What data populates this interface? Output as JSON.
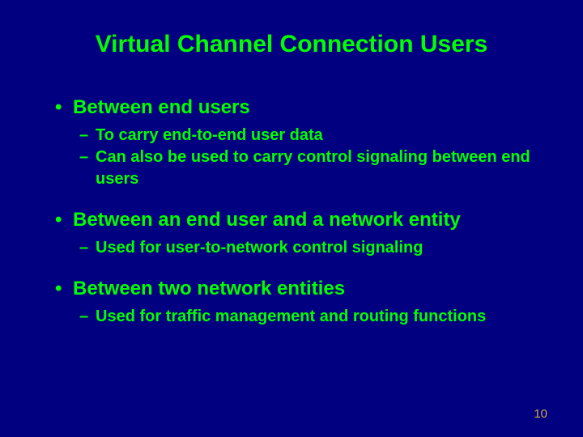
{
  "title": "Virtual Channel Connection Users",
  "bullets": [
    {
      "text": "Between end users",
      "subs": [
        "To carry end-to-end user data",
        "Can also be used to carry control signaling between end users"
      ]
    },
    {
      "text": "Between an end user and a network entity",
      "subs": [
        "Used for user-to-network control signaling"
      ]
    },
    {
      "text": "Between two network entities",
      "subs": [
        "Used for traffic management and routing functions"
      ]
    }
  ],
  "page_number": "10"
}
